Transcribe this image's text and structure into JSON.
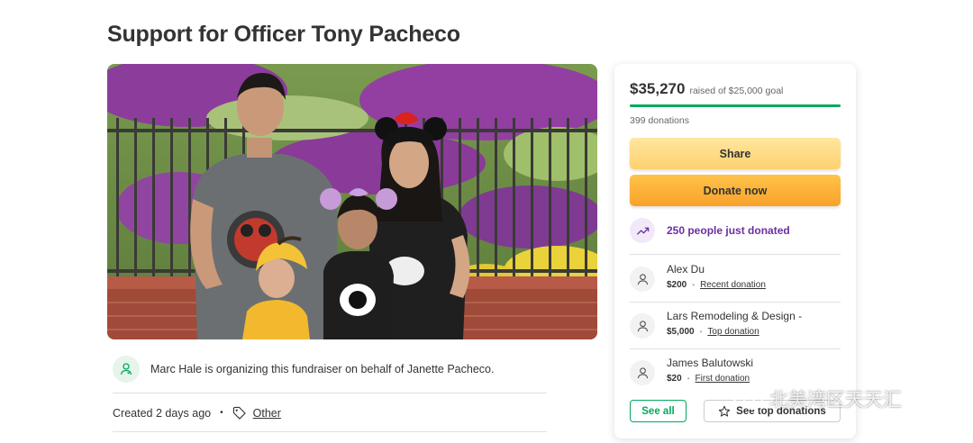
{
  "page": {
    "title": "Support for Officer Tony Pacheco"
  },
  "organizer": {
    "text": "Marc Hale is organizing this fundraiser on behalf of Janette Pacheco.",
    "avatar_icon": "person-heart-icon"
  },
  "meta": {
    "created": "Created 2 days ago",
    "dot": "•",
    "category": "Other",
    "tag_icon": "tag-icon"
  },
  "campaign": {
    "raised": "$35,270",
    "goal_text": "raised of $25,000 goal",
    "progress_fraction": 1.0,
    "donations": "399 donations",
    "share_label": "Share",
    "donate_label": "Donate now",
    "trend_text": "250 people just donated",
    "trend_icon": "trending-up-icon"
  },
  "donors": [
    {
      "name": "Alex Du",
      "amount": "$200",
      "sep": "•",
      "label": "Recent donation"
    },
    {
      "name": "Lars Remodeling & Design -",
      "amount": "$5,000",
      "sep": "•",
      "label": "Top donation"
    },
    {
      "name": "James Balutowski",
      "amount": "$20",
      "sep": "•",
      "label": "First donation"
    }
  ],
  "buttons": {
    "see_all": "See all",
    "see_top": "See top donations"
  },
  "watermark": {
    "text": "北美湾区天天汇"
  },
  "colors": {
    "accent_green": "#02a95c",
    "share_yellow": "#fdd16f",
    "donate_orange": "#f9a22a",
    "trend_purple": "#6b2fa0"
  }
}
